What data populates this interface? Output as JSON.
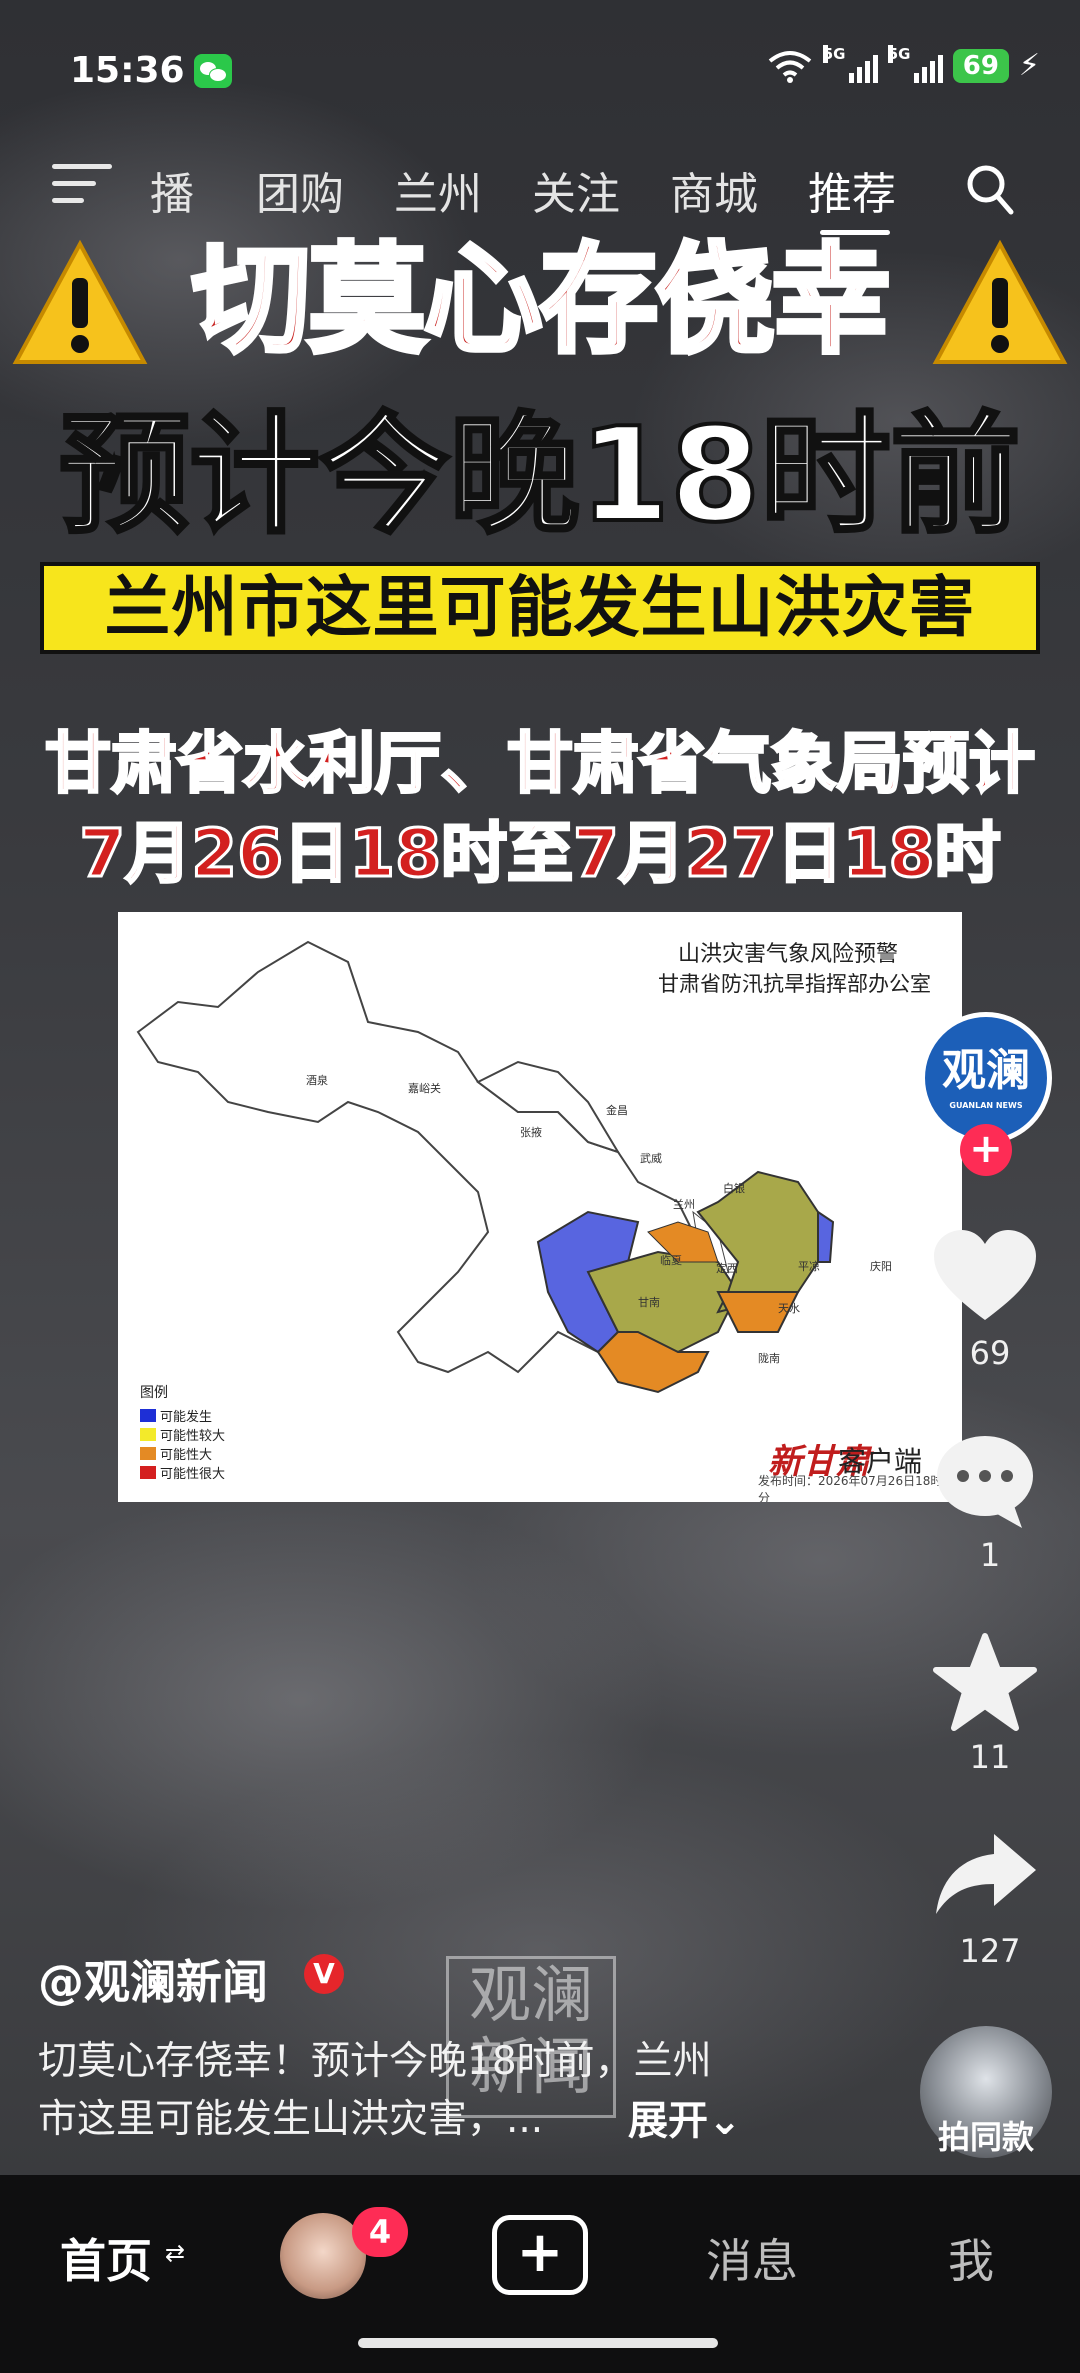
{
  "status_bar": {
    "time": "15:36",
    "network1": "5G",
    "network2": "5G",
    "battery": "69"
  },
  "nav": {
    "tabs": [
      {
        "label": "播"
      },
      {
        "label": "团购"
      },
      {
        "label": "兰州"
      },
      {
        "label": "关注"
      },
      {
        "label": "商城"
      },
      {
        "label": "推荐"
      }
    ],
    "active_tab": "推荐"
  },
  "video": {
    "headline": "切莫心存侥幸",
    "headline2": "预计今晚18时前",
    "banner": "兰州市这里可能发生山洪灾害",
    "subline1": "甘肃省水利厅、甘肃省气象局预计",
    "subline2": "7月26日18时至7月27日18时",
    "map": {
      "title": "山洪灾害气象风险预警",
      "org": "甘肃省防汛抗旱指挥部办公室",
      "legend_title": "图例",
      "legend": [
        {
          "label": "可能发生",
          "color": "#1e2fd6"
        },
        {
          "label": "可能性较大",
          "color": "#f3ea2a"
        },
        {
          "label": "可能性大",
          "color": "#e48a24"
        },
        {
          "label": "可能性很大",
          "color": "#d41f1f"
        }
      ],
      "brand": "新甘肃",
      "brand2": "客户端",
      "date_text": "发布时间：2026年07月26日18时21分",
      "places": [
        "酒泉",
        "嘉峪关",
        "张掖",
        "金昌",
        "武威",
        "白银",
        "兰州",
        "临夏",
        "定西",
        "甘南",
        "平凉",
        "天水",
        "陇南",
        "庆阳"
      ]
    },
    "watermark": "观澜新闻"
  },
  "side_rail": {
    "avatar_text": "观澜",
    "avatar_sub": "GUANLAN NEWS",
    "like_count": "69",
    "comment_count": "1",
    "favorite_count": "11",
    "share_count": "127",
    "same_style_label": "拍同款"
  },
  "post": {
    "username": "@观澜新闻",
    "verified": "V",
    "desc_line1": "切莫心存侥幸！预计今晚18时前，兰州",
    "desc_line2": "市这里可能发生山洪灾害，...",
    "expand": "展开"
  },
  "bottom_bar": {
    "home": "首页",
    "friends_badge": "4",
    "messages": "消息",
    "me": "我"
  },
  "colors": {
    "accent_red": "#fe2c55",
    "battery_green": "#3cc54a",
    "banner_yellow": "#f7e51c"
  }
}
